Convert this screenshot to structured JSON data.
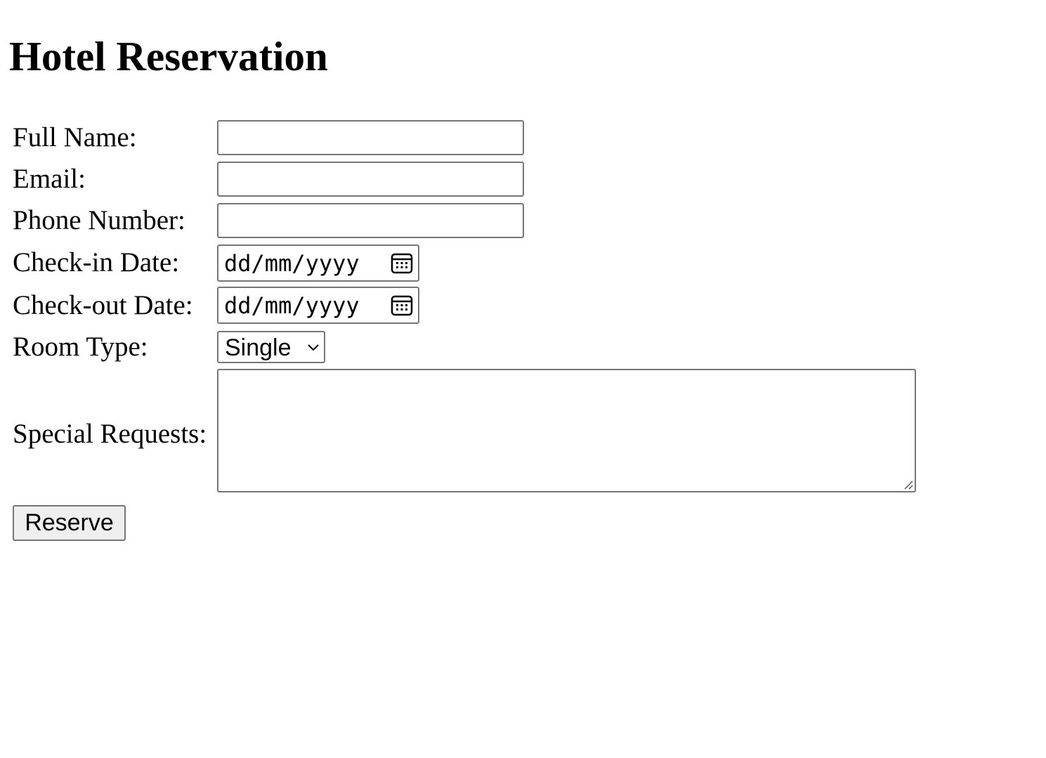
{
  "page": {
    "title": "Hotel Reservation"
  },
  "form": {
    "full_name": {
      "label": "Full Name:",
      "value": ""
    },
    "email": {
      "label": "Email:",
      "value": ""
    },
    "phone": {
      "label": "Phone Number:",
      "value": ""
    },
    "checkin": {
      "label": "Check-in Date:",
      "placeholder": "dd/mm/yyyy",
      "icon": "calendar-icon"
    },
    "checkout": {
      "label": "Check-out Date:",
      "placeholder": "dd/mm/yyyy",
      "icon": "calendar-icon"
    },
    "room_type": {
      "label": "Room Type:",
      "selected": "Single",
      "icon": "chevron-down-icon"
    },
    "special_requests": {
      "label": "Special Requests:",
      "value": ""
    },
    "submit_label": "Reserve"
  }
}
